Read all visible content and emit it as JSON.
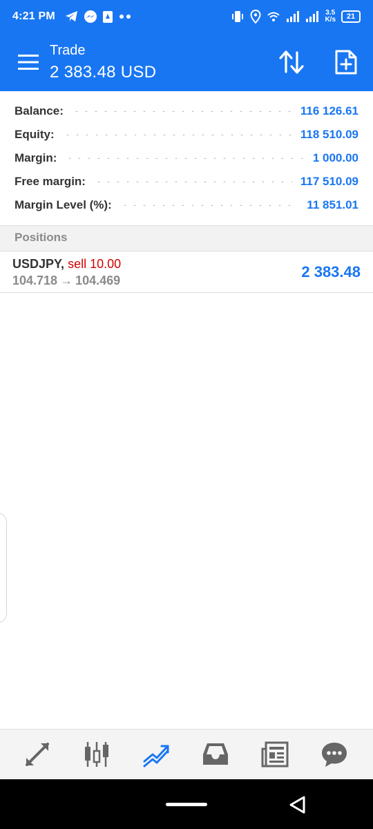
{
  "status_bar": {
    "time": "4:21 PM",
    "left_icons": [
      "telegram-icon",
      "messenger-icon",
      "app-notification-icon",
      "more-dots-icon"
    ],
    "right_icons": [
      "vibrate-icon",
      "location-icon",
      "wifi-icon",
      "signal-icon",
      "signal-icon"
    ],
    "net_speed_value": "3.5",
    "net_speed_unit": "K/s",
    "battery": "21"
  },
  "toolbar": {
    "title": "Trade",
    "amount": "2 383.48 USD",
    "menu_icon": "hamburger-menu-icon",
    "sort_icon": "sort-arrows-icon",
    "new_order_icon": "new-document-plus-icon"
  },
  "summary": [
    {
      "label": "Balance:",
      "value": "116 126.61"
    },
    {
      "label": "Equity:",
      "value": "118 510.09"
    },
    {
      "label": "Margin:",
      "value": "1 000.00"
    },
    {
      "label": "Free margin:",
      "value": "117 510.09"
    },
    {
      "label": "Margin Level (%):",
      "value": "11 851.01"
    }
  ],
  "positions_header": "Positions",
  "positions": [
    {
      "symbol": "USDJPY,",
      "side": "sell 10.00",
      "open_price": "104.718",
      "arrow": "→",
      "current_price": "104.469",
      "profit": "2 383.48"
    }
  ],
  "bottom_nav": [
    {
      "icon": "quotes-arrows-icon",
      "active": false
    },
    {
      "icon": "candlestick-chart-icon",
      "active": false
    },
    {
      "icon": "trade-trend-icon",
      "active": true
    },
    {
      "icon": "inbox-history-icon",
      "active": false
    },
    {
      "icon": "news-icon",
      "active": false
    },
    {
      "icon": "chat-bubble-icon",
      "active": false
    }
  ],
  "colors": {
    "accent": "#1976f3",
    "sell": "#d00000",
    "muted": "#8a8a8a",
    "nav_inactive": "#666666"
  }
}
